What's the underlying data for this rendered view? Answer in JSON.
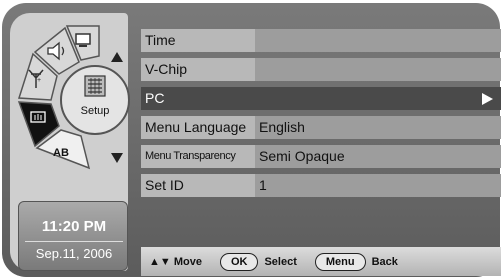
{
  "clock": {
    "time": "11:20 PM",
    "date": "Sep.11, 2006"
  },
  "wheel": {
    "center_label": "Setup",
    "ab_label": "AB",
    "icons": [
      "picture-icon",
      "sound-icon",
      "antenna-icon",
      "setup-icon",
      "input-icon",
      "caption-icon"
    ]
  },
  "menu": {
    "items": [
      {
        "label": "Time",
        "value": ""
      },
      {
        "label": "V-Chip",
        "value": ""
      },
      {
        "label": "PC",
        "value": ""
      },
      {
        "label": "Menu Language",
        "value": "English"
      },
      {
        "label": "Menu Transparency",
        "value": "Semi Opaque"
      },
      {
        "label": "Set ID",
        "value": "1"
      }
    ],
    "selected_index": 2
  },
  "footer": {
    "move_label": "▲▼ Move",
    "ok_key": "OK",
    "ok_label": "Select",
    "menu_key": "Menu",
    "menu_label": "Back"
  },
  "colors": {
    "frame": "#6b6b6b",
    "row_label": "#b8b8b8",
    "row_value": "#9d9d9d",
    "selected": "#4a4a4a"
  }
}
